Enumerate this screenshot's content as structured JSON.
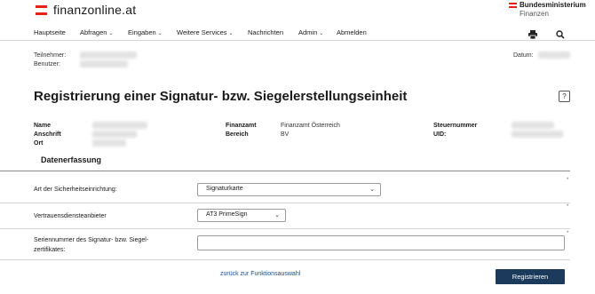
{
  "header": {
    "logo_text": "finanzonline.at",
    "ministry_line1": "Bundesministerium",
    "ministry_line2": "Finanzen"
  },
  "nav": {
    "items": [
      {
        "label": "Hauptseite",
        "has_menu": false
      },
      {
        "label": "Abfragen",
        "has_menu": true
      },
      {
        "label": "Eingaben",
        "has_menu": true
      },
      {
        "label": "Weitere Services",
        "has_menu": true
      },
      {
        "label": "Nachrichten",
        "has_menu": false
      },
      {
        "label": "Admin",
        "has_menu": true
      },
      {
        "label": "Abmelden",
        "has_menu": false
      }
    ],
    "chevron": "⌄",
    "icons": [
      "print-icon",
      "search-icon"
    ]
  },
  "meta": {
    "teilnehmer_label": "Teilnehmer:",
    "benutzer_label": "Benutzer:",
    "datum_label": "Datum:"
  },
  "page": {
    "title": "Registrierung einer Signatur- bzw. Siegelerstellungseinheit",
    "help": "?"
  },
  "info": {
    "name_label": "Name",
    "anschrift_label": "Anschrift",
    "ort_label": "Ort",
    "finanzamt_label": "Finanzamt",
    "finanzamt_value": "Finanzamt Österreich",
    "bereich_label": "Bereich",
    "bereich_value": "BV",
    "steuernummer_label": "Steuernummer",
    "uid_label": "UID:"
  },
  "form": {
    "section_title": "Datenerfassung",
    "sicherheit_label": "Art der Sicherheitseinrichtung:",
    "sicherheit_value": "Signaturkarte",
    "vda_label": "Vertrauensdiensteanbieter",
    "vda_value": "AT3 PrimeSign",
    "serial_label_1": "Seriennummer des Signatur- bzw. Siegel-",
    "serial_label_2": "zertifikates:",
    "serial_value": "",
    "required_marker": "*"
  },
  "footer": {
    "back_link": "zurück zur Funktionsauswahl",
    "submit": "Registrieren"
  },
  "colors": {
    "brand_red": "#e2231a",
    "primary_button": "#1b3a5c",
    "link": "#1a4e8a"
  }
}
